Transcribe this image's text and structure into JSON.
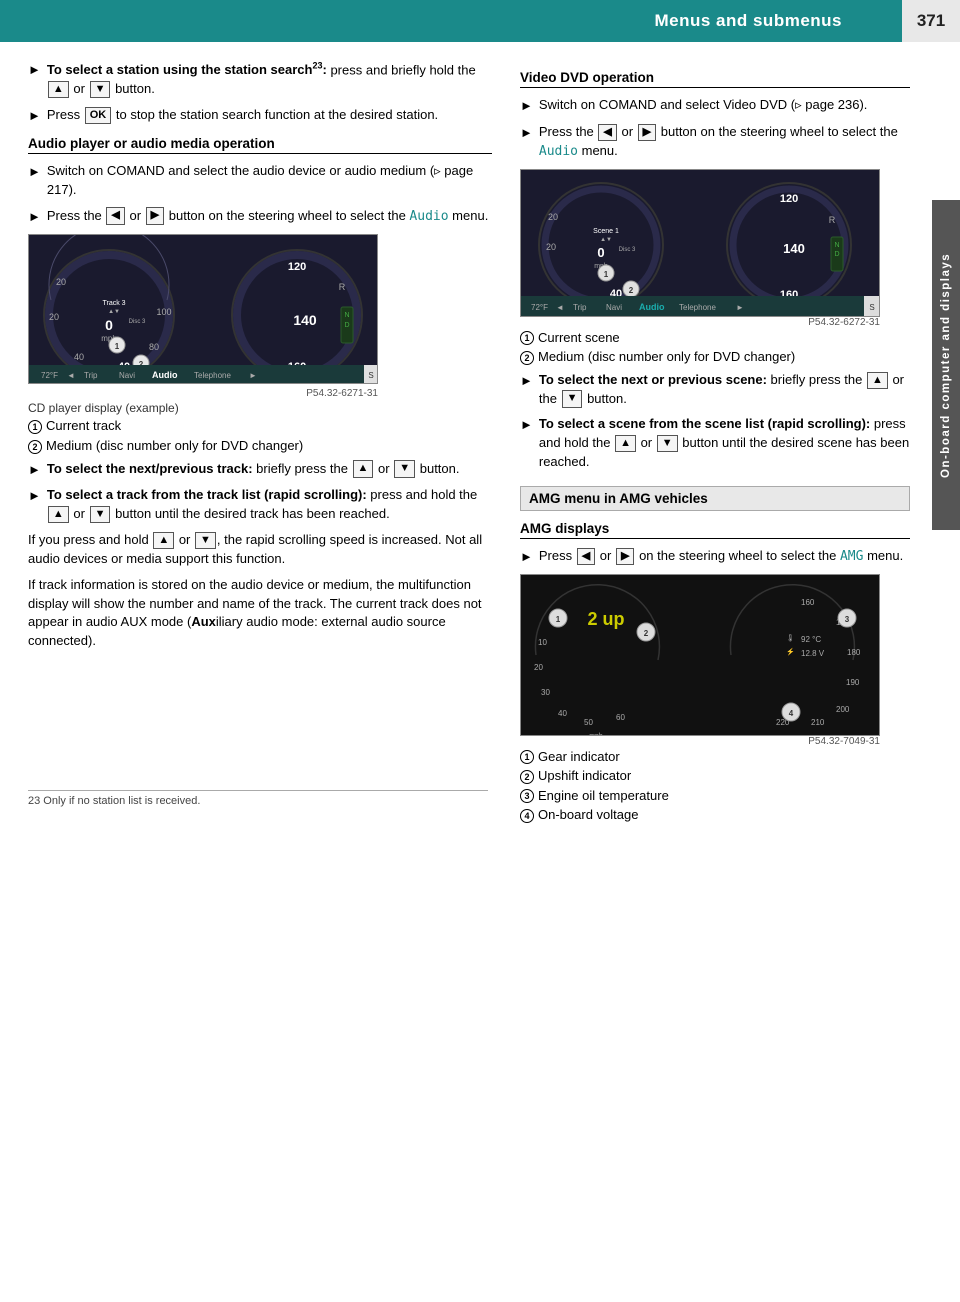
{
  "header": {
    "title": "Menus and submenus",
    "page_number": "371"
  },
  "sidebar": {
    "label": "On-board computer and displays"
  },
  "left_column": {
    "bullet1": {
      "prefix": "To select a station using the station search",
      "superscript": "23",
      "text": ": press and briefly hold the",
      "btn1": "▲",
      "middle": "or",
      "btn2": "▼",
      "suffix": "button."
    },
    "bullet2": {
      "prefix": "Press",
      "btn": "OK",
      "suffix": "to stop the station search function at the desired station."
    },
    "section1": "Audio player or audio media operation",
    "bullet3": {
      "text": "Switch on COMAND and select the audio device or audio medium (▶ page 217)."
    },
    "bullet4": {
      "prefix": "Press the",
      "btn1": "◄",
      "middle": "or",
      "btn2": "►",
      "suffix": "button on the steering wheel to select the",
      "audio_text": "Audio",
      "end": "menu."
    },
    "img1": {
      "caption": "P54.32-6271-31",
      "sub_caption": "CD player display (example)"
    },
    "numbered1": {
      "num": "1",
      "text": "Current track"
    },
    "numbered2": {
      "num": "2",
      "text": "Medium (disc number only for DVD changer)"
    },
    "bullet5": {
      "bold": "To select the next/previous track:",
      "text": "briefly press the",
      "btn1": "▲",
      "middle": "or",
      "btn2": "▼",
      "suffix": "button."
    },
    "bullet6": {
      "bold": "To select a track from the track list (rapid scrolling):",
      "text": "press and hold the",
      "btn1": "▲",
      "middle": "or",
      "btn2": "▼",
      "suffix": "button until the desired track has been reached."
    },
    "para1": "If you press and hold",
    "para1_btn1": "▲",
    "para1_mid": "or",
    "para1_btn2": "▼",
    "para1_end": ", the rapid scrolling speed is increased. Not all audio devices or media support this function.",
    "para2": "If track information is stored on the audio device or medium, the multifunction display will show the number and name of the track. The current track does not appear in audio AUX mode (Auxiliary audio mode: external audio source connected).",
    "footnote": "23 Only if no station list is received."
  },
  "right_column": {
    "section_video": "Video DVD operation",
    "video_bullet1": {
      "text": "Switch on COMAND and select Video DVD (▶ page 236)."
    },
    "video_bullet2": {
      "prefix": "Press the",
      "btn1": "◄",
      "middle": "or",
      "btn2": "►",
      "suffix": "button on the steering wheel to select the",
      "audio_text": "Audio",
      "end": "menu."
    },
    "img2": {
      "caption": "P54.32-6272-31"
    },
    "video_num1": {
      "num": "1",
      "text": "Current scene"
    },
    "video_num2": {
      "num": "2",
      "text": "Medium (disc number only for DVD changer)"
    },
    "video_bullet3": {
      "bold": "To select the next or previous scene:",
      "text": "briefly press the",
      "btn1": "▲",
      "middle": "or the",
      "btn2": "▼",
      "suffix": "button."
    },
    "video_bullet4": {
      "bold": "To select a scene from the scene list (rapid scrolling):",
      "text": "press and hold the",
      "btn1": "▲",
      "middle": "or",
      "btn2": "▼",
      "suffix": "button until the desired scene has been reached."
    },
    "section_amg_box": "AMG menu in AMG vehicles",
    "section_amg": "AMG displays",
    "amg_bullet1": {
      "prefix": "Press",
      "btn1": "◄",
      "middle": "or",
      "btn2": "►",
      "suffix": "on the steering wheel to select the",
      "amg_text": "AMG",
      "end": "menu."
    },
    "img3": {
      "caption": "P54.32-7049-31"
    },
    "amg_num1": {
      "num": "1",
      "text": "Gear indicator"
    },
    "amg_num2": {
      "num": "2",
      "text": "Upshift indicator"
    },
    "amg_num3": {
      "num": "3",
      "text": "Engine oil temperature"
    },
    "amg_num4": {
      "num": "4",
      "text": "On-board voltage"
    }
  }
}
